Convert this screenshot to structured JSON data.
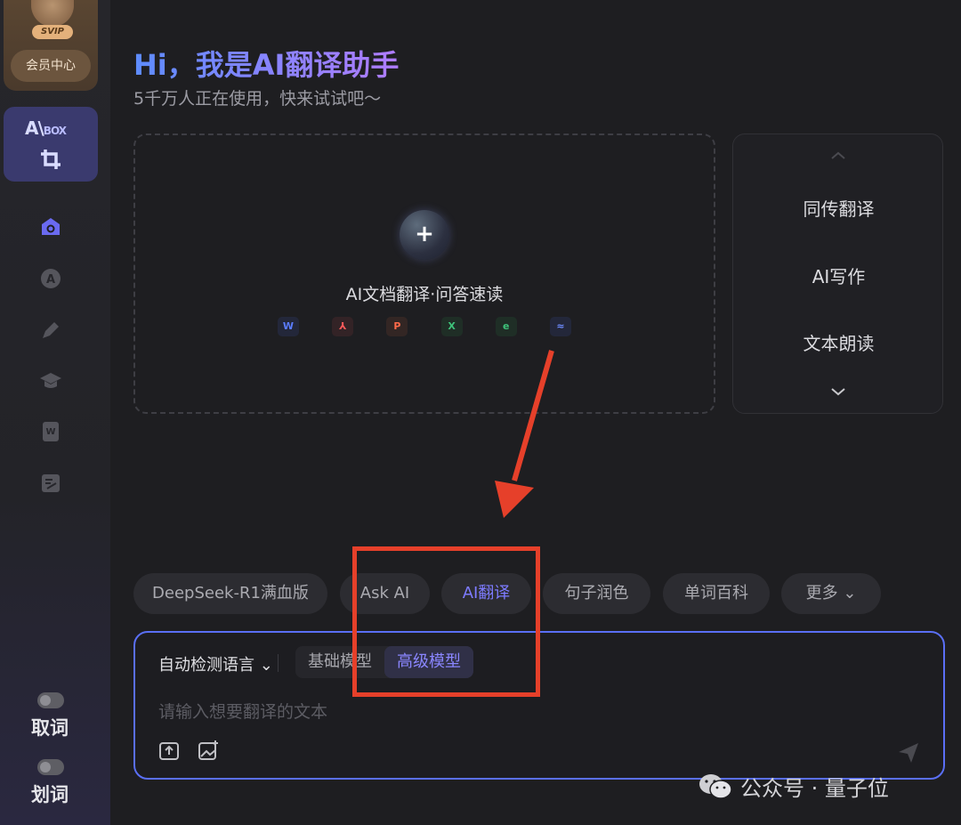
{
  "sidebar": {
    "vip_tag": "SVIP",
    "vip_button": "会员中心",
    "aibox_logo_main": "A\\",
    "aibox_logo_sub": "BOX",
    "nav_icons": [
      "search-home-icon",
      "ai-icon",
      "pen-icon",
      "graduation-cap-icon",
      "word-doc-icon",
      "edit-note-icon"
    ],
    "toggles": [
      {
        "label": "取词",
        "enabled": false
      },
      {
        "label": "划词",
        "enabled": false
      }
    ]
  },
  "header": {
    "title": "Hi，我是AI翻译助手",
    "subtitle": "5千万人正在使用，快来试试吧～"
  },
  "upload": {
    "plus": "+",
    "label": "AI文档翻译·问答速读",
    "file_types": [
      {
        "glyph": "W",
        "icon": "word-icon",
        "color": "#5b7cff",
        "bg": "#23273a"
      },
      {
        "glyph": "⅄",
        "icon": "pdf-icon",
        "color": "#ff5a5a",
        "bg": "#332326"
      },
      {
        "glyph": "P",
        "icon": "ppt-icon",
        "color": "#ff6a4a",
        "bg": "#332624"
      },
      {
        "glyph": "X",
        "icon": "excel-icon",
        "color": "#3ec27a",
        "bg": "#1f2e26"
      },
      {
        "glyph": "e",
        "icon": "epub-icon",
        "color": "#3ec27a",
        "bg": "#1f2e26"
      },
      {
        "glyph": "≈",
        "icon": "image-icon",
        "color": "#6e8cff",
        "bg": "#23273a"
      }
    ]
  },
  "tools": {
    "items": [
      "同传翻译",
      "AI写作",
      "文本朗读"
    ]
  },
  "chips": [
    {
      "label": "DeepSeek-R1满血版",
      "active": false
    },
    {
      "label": "Ask AI",
      "active": false
    },
    {
      "label": "AI翻译",
      "active": true
    },
    {
      "label": "句子润色",
      "active": false
    },
    {
      "label": "单词百科",
      "active": false
    },
    {
      "label": "更多 ⌄",
      "active": false
    }
  ],
  "input": {
    "source_language": "自动检测语言 ⌄",
    "model_basic": "基础模型",
    "model_advanced": "高级模型",
    "selected_model": "高级模型",
    "placeholder": "请输入想要翻译的文本"
  },
  "watermark": {
    "text": "公众号 · 量子位"
  },
  "colors": {
    "accent": "#5a6ff6",
    "highlight": "#e6402a",
    "chip_active": "#7d7bff"
  }
}
